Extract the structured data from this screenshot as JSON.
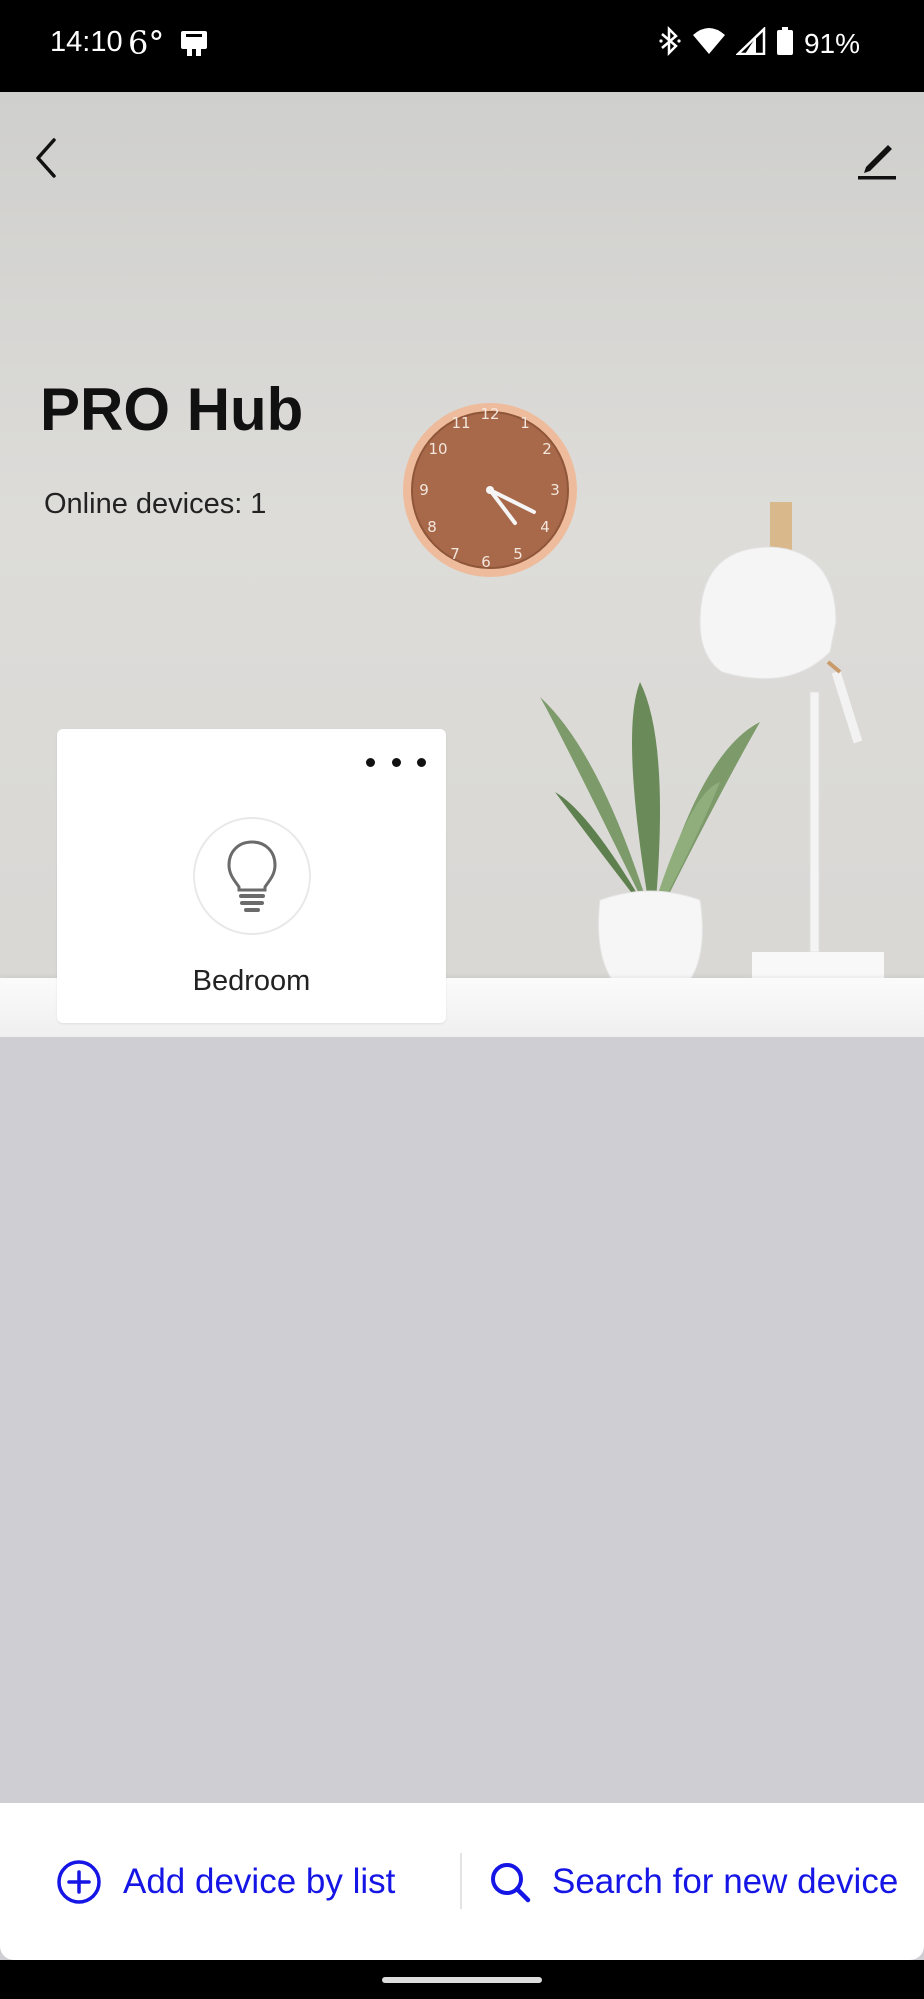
{
  "status_bar": {
    "time": "14:10",
    "temperature": "6°",
    "battery_percent": "91%",
    "icons": [
      "notification-icon",
      "bluetooth-icon",
      "wifi-icon",
      "signal-icon",
      "battery-icon"
    ]
  },
  "header": {
    "back_icon": "chevron-left-icon",
    "edit_icon": "pencil-icon"
  },
  "hub": {
    "title": "PRO Hub",
    "online_label": "Online devices:",
    "online_count": "1"
  },
  "devices": [
    {
      "label": "Bedroom",
      "icon": "light-bulb-icon",
      "menu_icon": "more-horizontal-icon"
    }
  ],
  "actions": {
    "add_label": "Add device by list",
    "search_label": "Search for new device",
    "accent_color": "#1515e6"
  }
}
